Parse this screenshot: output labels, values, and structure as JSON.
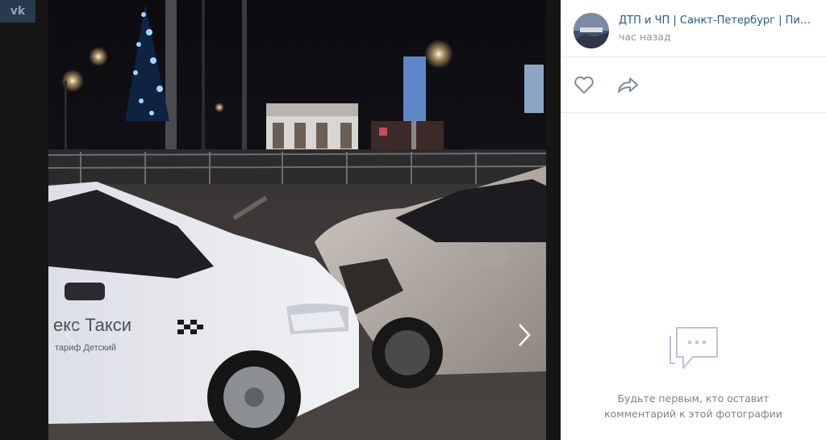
{
  "header": {
    "group_name": "ДТП и ЧП | Санкт-Петербург | Питер Онлайн | СПб",
    "post_time": "час назад"
  },
  "photo": {
    "taxi_text": "екс Такси",
    "taxi_subtext": "тариф Детский"
  },
  "comments": {
    "empty_line1": "Будьте первым, кто оставит",
    "empty_line2": "комментарий к этой фотографии"
  },
  "icons": {
    "like": "heart-icon",
    "share": "share-arrow-icon",
    "comments": "comment-bubble-icon",
    "next": "chevron-right-icon",
    "prev": "chevron-left-icon"
  },
  "colors": {
    "link": "#2a5885",
    "muted": "#939393",
    "icon": "#828a99"
  }
}
